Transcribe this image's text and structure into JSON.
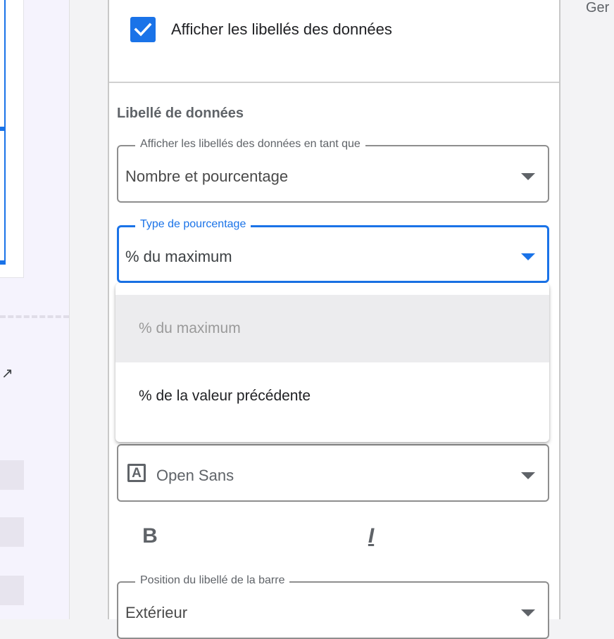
{
  "right_edge_text": "Ger",
  "panel": {
    "show_labels_checkbox": {
      "label": "Afficher les libellés des données",
      "checked": true
    },
    "section_title": "Libellé de données",
    "display_as": {
      "legend": "Afficher les libellés des données en tant que",
      "value": "Nombre et pourcentage"
    },
    "percentage_type": {
      "legend": "Type de pourcentage",
      "value": "% du maximum"
    },
    "font": {
      "icon": "font-family-icon",
      "icon_glyph": "A",
      "value": "Open Sans"
    },
    "style": {
      "bold_label": "B",
      "italic_label": "I"
    },
    "bar_label_position": {
      "legend": "Position du libellé de la barre",
      "value": "Extérieur"
    }
  },
  "dropdown_menu": {
    "options": [
      {
        "label": "% du maximum",
        "selected": true
      },
      {
        "label": "% de la valeur précédente",
        "selected": false
      }
    ]
  },
  "colors": {
    "accent": "#1a73e8",
    "border": "#8e8e8e",
    "selected_option_bg": "#ececee"
  }
}
